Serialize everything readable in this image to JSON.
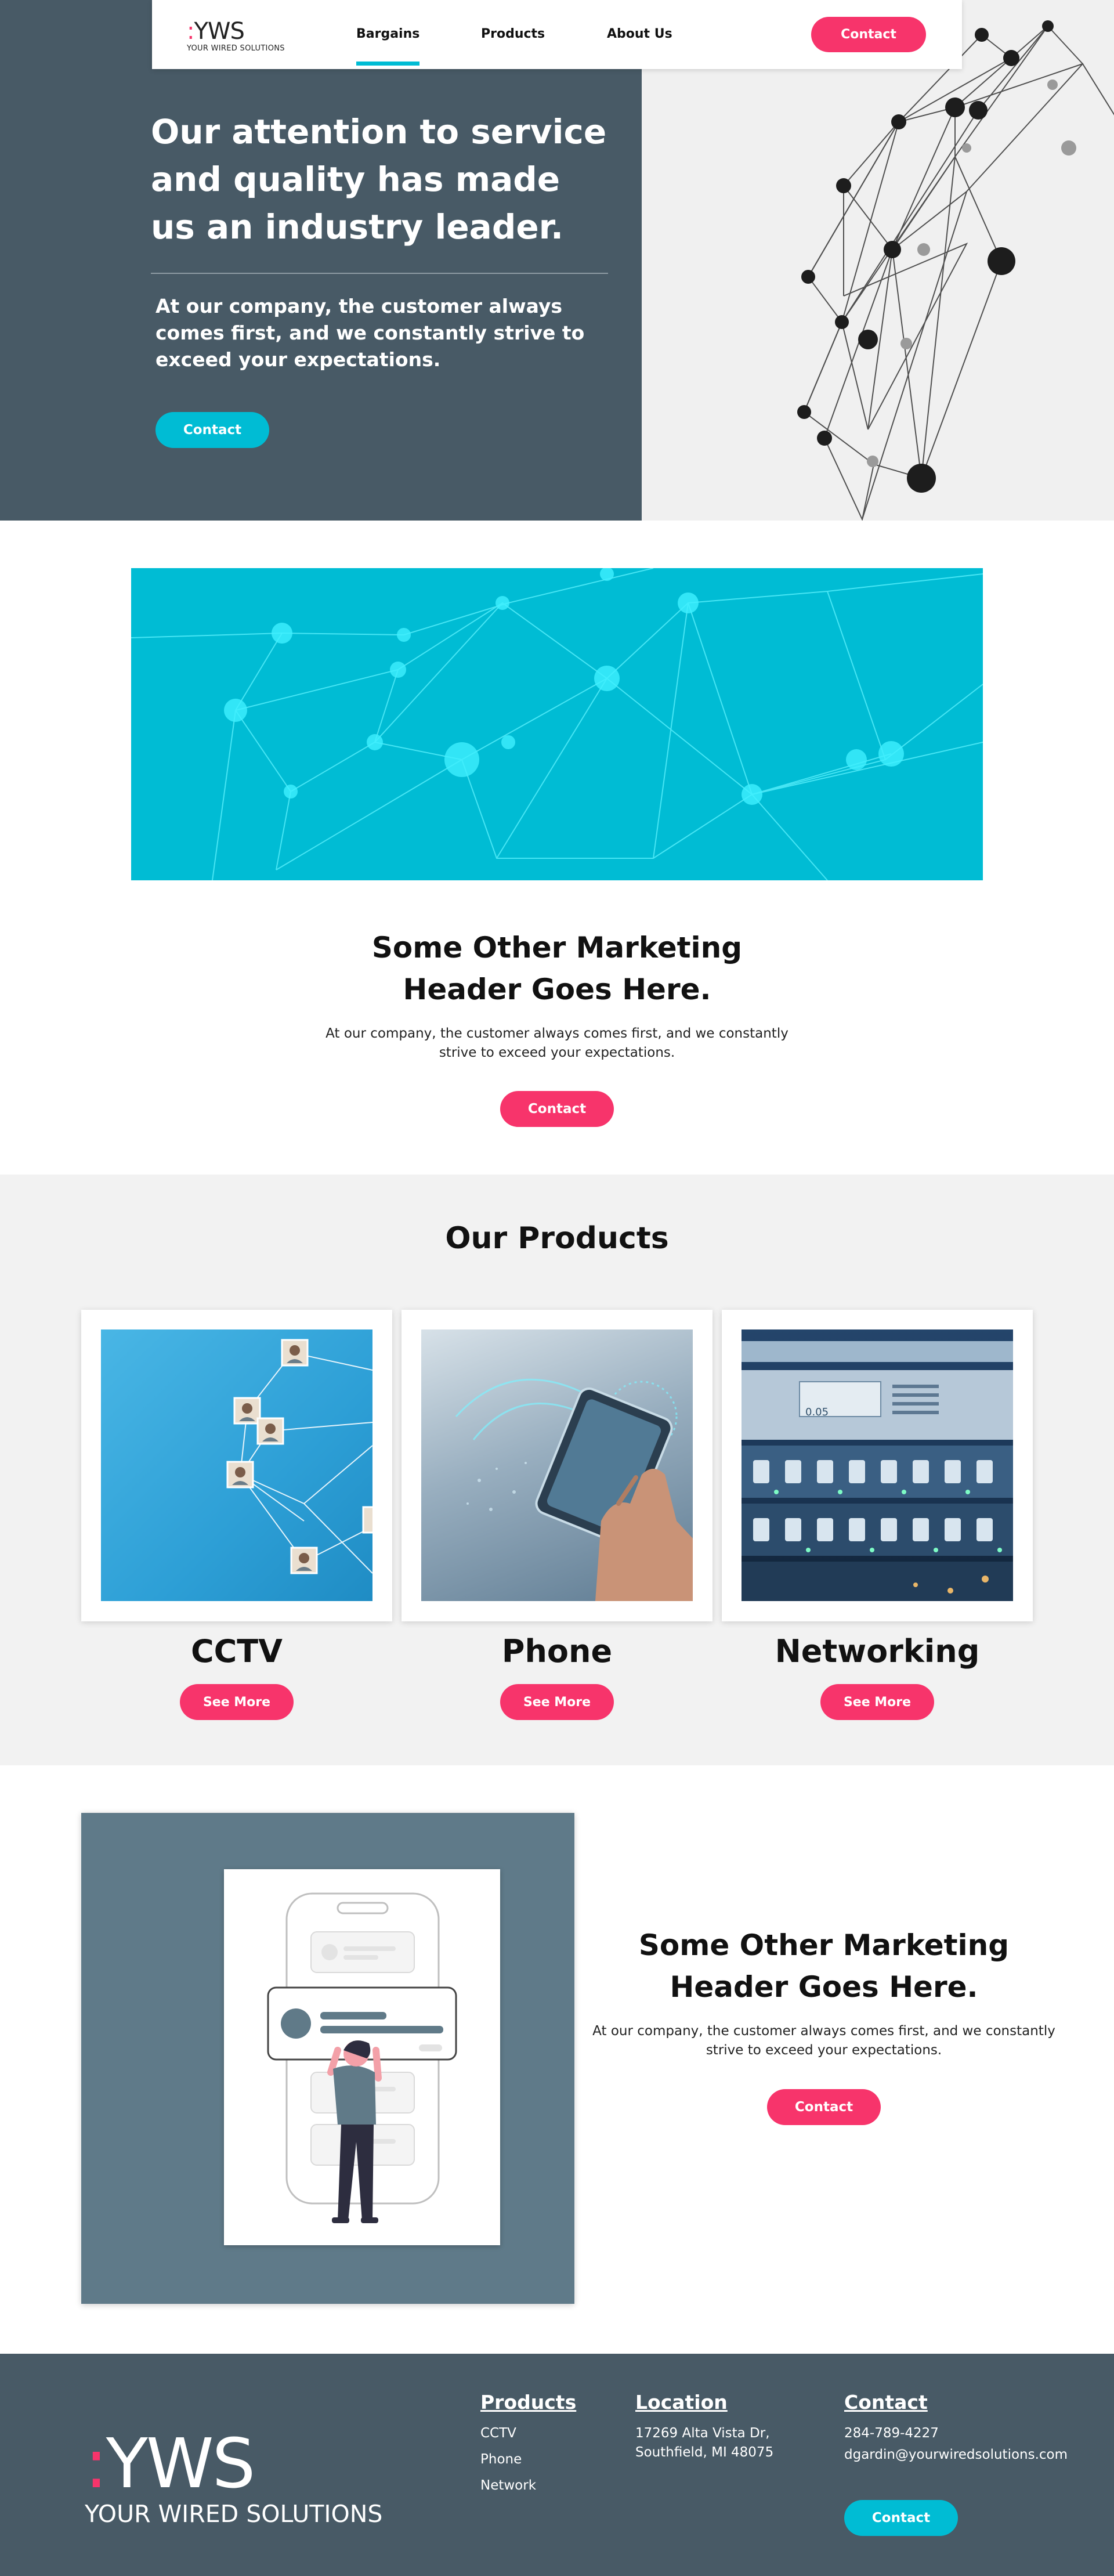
{
  "nav": {
    "logo_mark": "YWS",
    "logo_sub": "YOUR WIRED SOLUTIONS",
    "items": [
      {
        "label": "Bargains",
        "active": true
      },
      {
        "label": "Products",
        "active": false
      },
      {
        "label": "About Us",
        "active": false
      }
    ],
    "contact_label": "Contact"
  },
  "hero": {
    "title": "Our attention to service and quality has made us an industry leader.",
    "body": "At our company, the customer always comes first, and we constantly strive to exceed your expectations.",
    "contact_label": "Contact"
  },
  "marketing1": {
    "title": "Some Other Marketing Header Goes Here.",
    "body": "At our company, the customer always comes first, and we constantly strive to exceed your expectations.",
    "contact_label": "Contact"
  },
  "products": {
    "title": "Our Products",
    "items": [
      {
        "label": "CCTV",
        "button": "See More"
      },
      {
        "label": "Phone",
        "button": "See More"
      },
      {
        "label": "Networking",
        "button": "See More"
      }
    ],
    "server_readout": "0.05"
  },
  "marketing2": {
    "title": "Some Other Marketing Header Goes Here.",
    "body": "At our company, the customer always comes first, and we constantly strive to exceed your expectations.",
    "contact_label": "Contact"
  },
  "footer": {
    "logo_mark": "YWS",
    "logo_sub": "YOUR WIRED SOLUTIONS",
    "products": {
      "heading": "Products",
      "items": [
        "CCTV",
        "Phone",
        "Network"
      ]
    },
    "location": {
      "heading": "Location",
      "line1": "17269 Alta Vista Dr,",
      "line2": "Southfield, MI 48075"
    },
    "contact": {
      "heading": "Contact",
      "phone": "284-789-4227",
      "email": "dgardin@yourwiredsolutions.com",
      "button": "Contact"
    }
  },
  "colors": {
    "accent_pink": "#f7346b",
    "accent_teal": "#00bcd4",
    "slate": "#485a66",
    "panel": "#5f7a89",
    "light_bg": "#f2f2f2"
  }
}
